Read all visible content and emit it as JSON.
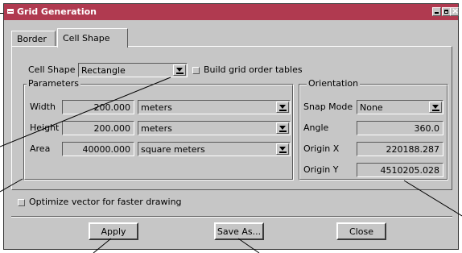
{
  "window": {
    "title": "Grid Generation",
    "controls": [
      "minimize-icon",
      "maximize-icon",
      "close-icon"
    ],
    "close_glyph": "×"
  },
  "tabs": [
    {
      "label": "Border",
      "active": false
    },
    {
      "label": "Cell Shape",
      "active": true
    }
  ],
  "cell_shape": {
    "label": "Cell Shape",
    "value": "Rectangle",
    "build_grid_label": "Build grid order tables",
    "build_grid_checked": false
  },
  "parameters": {
    "group_label": "Parameters",
    "width": {
      "label": "Width",
      "value": "200.000",
      "unit": "meters"
    },
    "height": {
      "label": "Height",
      "value": "200.000",
      "unit": "meters"
    },
    "area": {
      "label": "Area",
      "value": "40000.000",
      "unit": "square meters"
    }
  },
  "orientation": {
    "group_label": "Orientation",
    "snap_mode": {
      "label": "Snap Mode",
      "value": "None"
    },
    "angle": {
      "label": "Angle",
      "value": "360.0"
    },
    "origin_x": {
      "label": "Origin X",
      "value": "220188.287"
    },
    "origin_y": {
      "label": "Origin Y",
      "value": "4510205.028"
    }
  },
  "optimize": {
    "label": "Optimize vector for faster drawing",
    "checked": false
  },
  "buttons": {
    "apply": "Apply",
    "save_as": "Save As...",
    "close": "Close"
  },
  "colors": {
    "titlebar": "#b03a50",
    "face": "#c6c6c6",
    "callout_line": "#000000"
  }
}
